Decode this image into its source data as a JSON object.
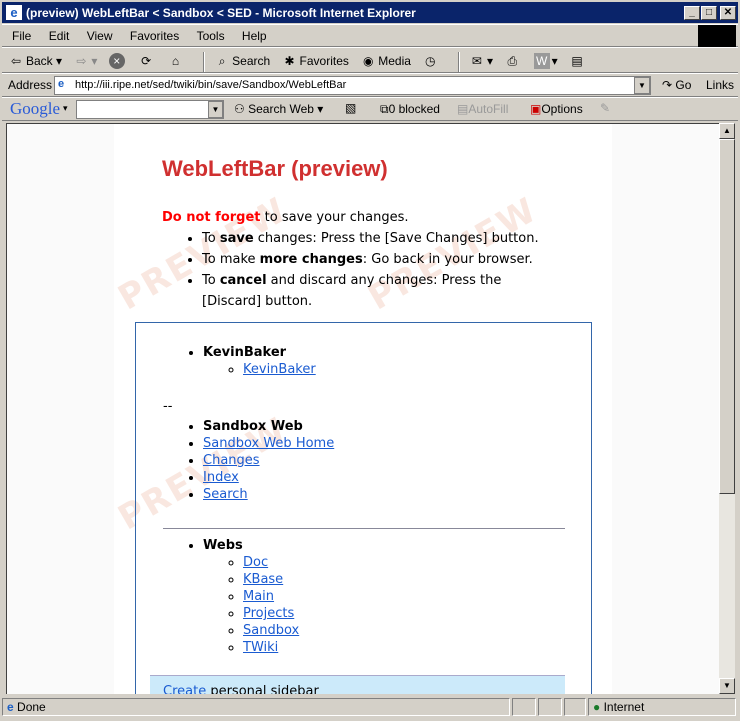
{
  "window": {
    "title": "(preview) WebLeftBar < Sandbox < SED - Microsoft Internet Explorer"
  },
  "menu": [
    "File",
    "Edit",
    "View",
    "Favorites",
    "Tools",
    "Help"
  ],
  "toolbar": {
    "back": "Back",
    "search": "Search",
    "favorites": "Favorites",
    "media": "Media"
  },
  "address": {
    "label": "Address",
    "url": "http://iii.ripe.net/sed/twiki/bin/save/Sandbox/WebLeftBar",
    "go": "Go",
    "links": "Links"
  },
  "google": {
    "logo": "Google",
    "search_value": "",
    "search_web": "Search Web",
    "blocked": "0 blocked",
    "autofill": "AutoFill",
    "options": "Options"
  },
  "page": {
    "heading": "WebLeftBar (preview)",
    "warning_strong": "Do not forget",
    "warning_rest": " to save your changes.",
    "bullets": [
      {
        "pre": "To ",
        "bold": "save",
        "post": " changes: Press the [Save Changes] button."
      },
      {
        "pre": "To make ",
        "bold": "more changes",
        "post": ": Go back in your browser."
      },
      {
        "pre": "To ",
        "bold": "cancel",
        "post": " and discard any changes: Press the [Discard] button."
      }
    ],
    "watermark": "PREVIEW",
    "user_heading": "KevinBaker",
    "user_link": "KevinBaker",
    "dashes": "--",
    "web_heading": "Sandbox Web",
    "web_links": [
      "Sandbox Web Home",
      "Changes",
      "Index",
      "Search"
    ],
    "webs_heading": "Webs",
    "webs": [
      "Doc",
      "KBase",
      "Main",
      "Projects",
      "Sandbox",
      "TWiki"
    ],
    "create_link": "Create",
    "create_rest": " personal sidebar"
  },
  "status": {
    "text": "Done",
    "zone": "Internet"
  }
}
